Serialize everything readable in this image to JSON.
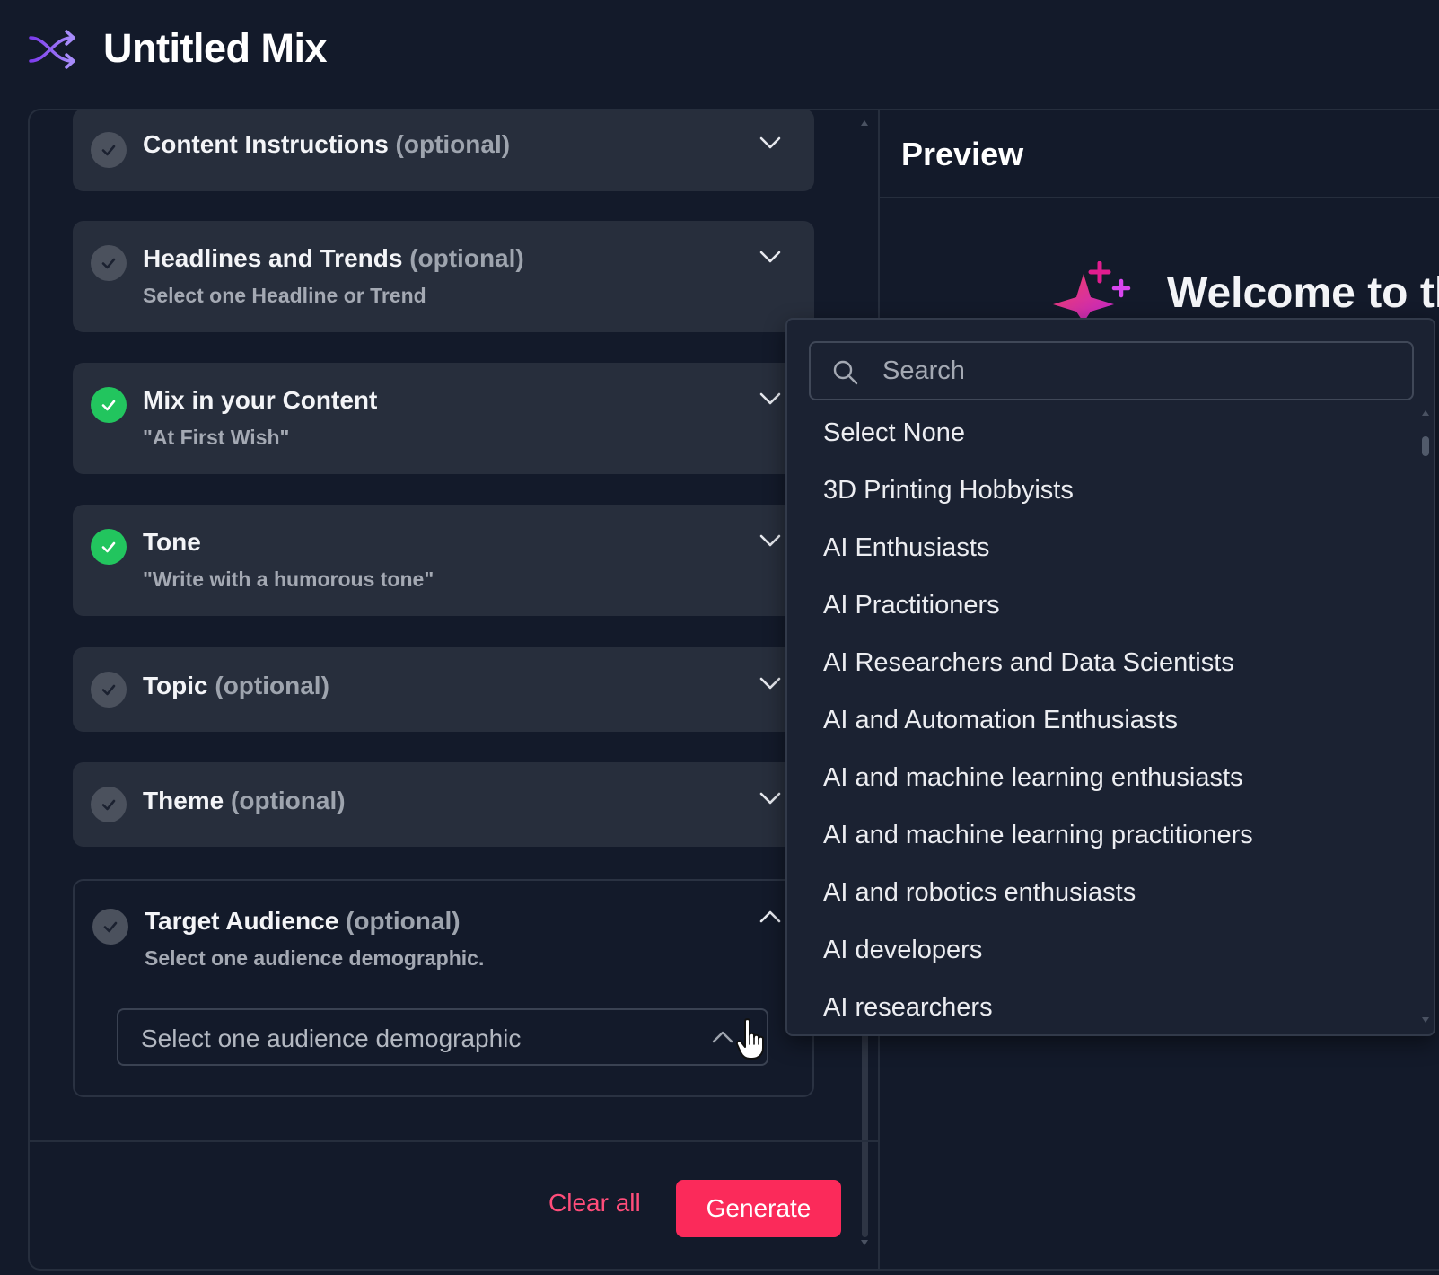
{
  "header": {
    "title": "Untitled Mix"
  },
  "sections": [
    {
      "title": "Content Instructions",
      "optional": "(optional)",
      "subtitle": "",
      "done": false
    },
    {
      "title": "Headlines and Trends",
      "optional": "(optional)",
      "subtitle": "Select one Headline or Trend",
      "done": false
    },
    {
      "title": "Mix in your Content",
      "optional": "",
      "subtitle": "\"At First Wish\"",
      "done": true
    },
    {
      "title": "Tone",
      "optional": "",
      "subtitle": "\"Write with a humorous tone\"",
      "done": true
    },
    {
      "title": "Topic",
      "optional": "(optional)",
      "subtitle": "",
      "done": false
    },
    {
      "title": "Theme",
      "optional": "(optional)",
      "subtitle": "",
      "done": false
    },
    {
      "title": "Target Audience",
      "optional": "(optional)",
      "subtitle": "Select one audience demographic.",
      "done": false
    }
  ],
  "audience_select": {
    "placeholder": "Select one audience demographic"
  },
  "footer": {
    "clear_label": "Clear all",
    "generate_label": "Generate"
  },
  "preview": {
    "title": "Preview",
    "welcome": "Welcome to th"
  },
  "dropdown": {
    "search_placeholder": "Search",
    "options": [
      "Select None",
      "3D Printing Hobbyists",
      "AI Enthusiasts",
      "AI Practitioners",
      "AI Researchers and Data Scientists",
      "AI and Automation Enthusiasts",
      "AI and machine learning enthusiasts",
      "AI and machine learning practitioners",
      "AI and robotics enthusiasts",
      "AI developers",
      "AI researchers"
    ]
  },
  "colors": {
    "accent": "#fb2a5a",
    "done_green": "#22c55e",
    "background": "#131a2a",
    "card": "#272e3c",
    "logo_purple": "#8b5cf6"
  },
  "icons": [
    "shuffle-icon",
    "check-icon",
    "chevron-down-icon",
    "chevron-up-icon",
    "search-icon",
    "sparkle-icon",
    "hand-cursor-icon"
  ]
}
